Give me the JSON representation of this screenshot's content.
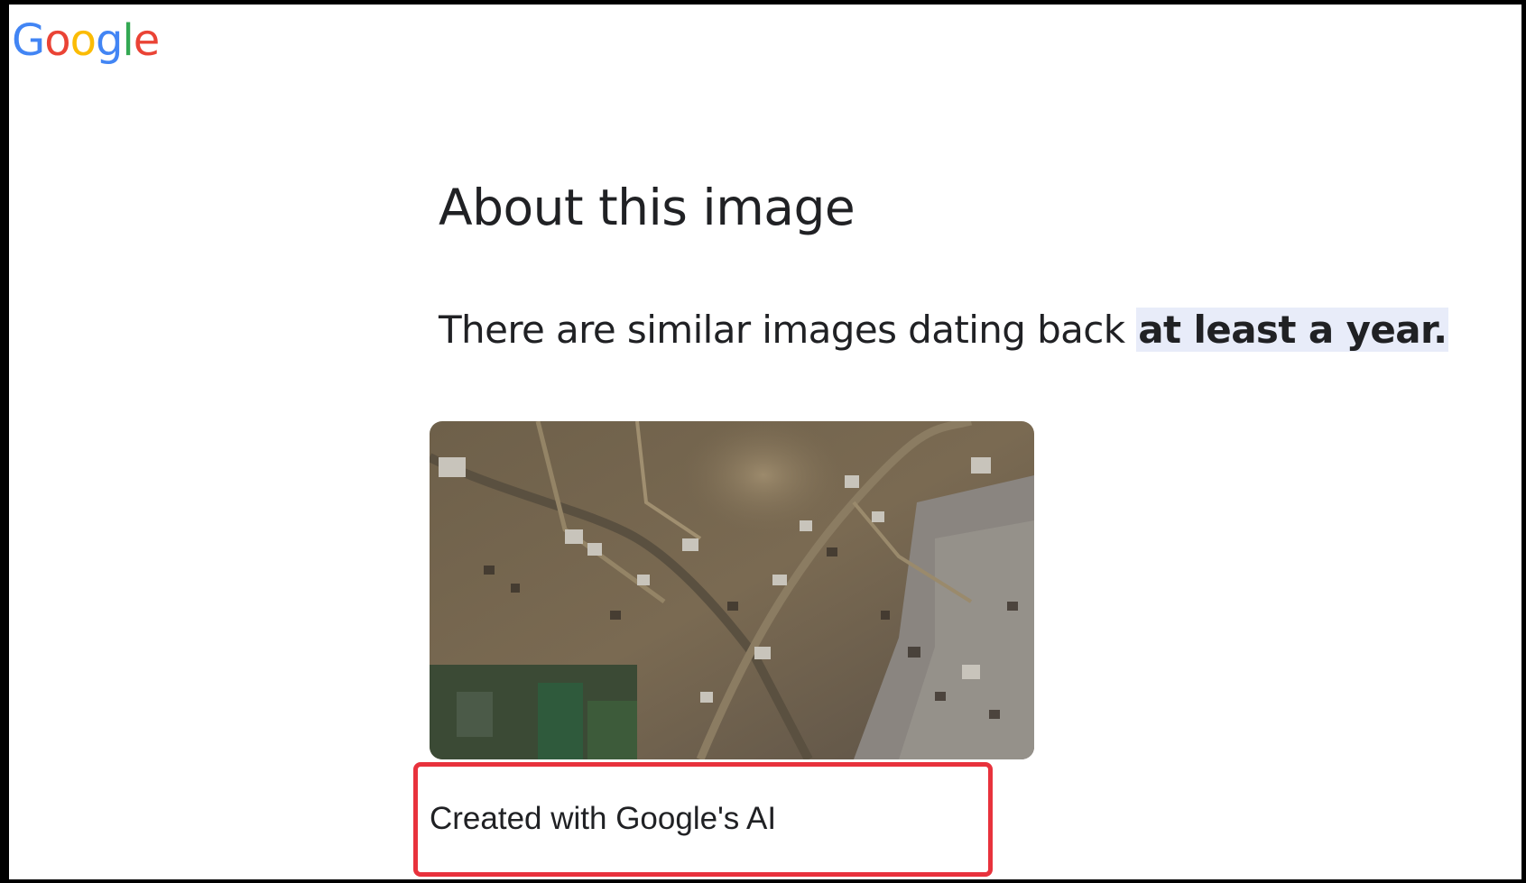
{
  "header": {
    "logo_text": "Google",
    "logo_colors": [
      "#4285F4",
      "#EA4335",
      "#FBBC05",
      "#4285F4",
      "#34A853",
      "#EA4335"
    ]
  },
  "main": {
    "title": "About this image",
    "similar_prefix": "There are similar images dating back ",
    "similar_highlight": "at least a year.",
    "image_icon": "aerial-photo",
    "ai_label": "Created with Google's AI"
  },
  "colors": {
    "highlight_bg": "#e8ecf9",
    "annotation_border": "#e8323c",
    "text": "#202124"
  }
}
